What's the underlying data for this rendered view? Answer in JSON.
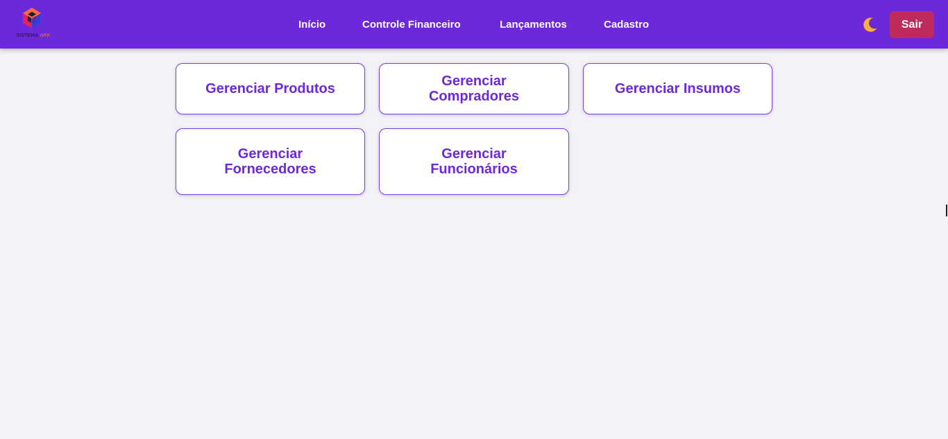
{
  "brand": {
    "logo_text_main": "SISTEMA ",
    "logo_text_accent": "ARK"
  },
  "nav": {
    "items": [
      {
        "label": "Início"
      },
      {
        "label": "Controle Financeiro"
      },
      {
        "label": "Lançamentos"
      },
      {
        "label": "Cadastro"
      }
    ]
  },
  "header": {
    "theme_toggle_icon": "moon-icon",
    "logout_label": "Sair"
  },
  "cards": [
    {
      "label": "Gerenciar Produtos"
    },
    {
      "label": "Gerenciar Compradores"
    },
    {
      "label": "Gerenciar Insumos"
    },
    {
      "label": "Gerenciar Fornecedores"
    },
    {
      "label": "Gerenciar Funcionários"
    }
  ],
  "colors": {
    "primary": "#6d28d9",
    "logout": "#be2a5a",
    "background": "#f3f2f7",
    "card_text": "#6d28d9"
  }
}
